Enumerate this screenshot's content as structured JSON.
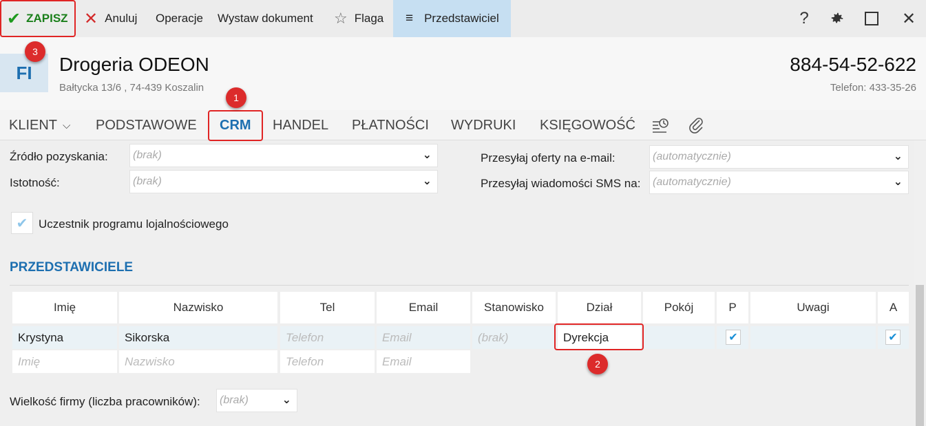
{
  "toolbar": {
    "save": "ZAPISZ",
    "cancel": "Anuluj",
    "operations": "Operacje",
    "issue_document": "Wystaw dokument",
    "flag": "Flaga",
    "representative": "Przedstawiciel",
    "help_icon": "?",
    "settings_icon": "gear-icon",
    "maximize_icon": "maximize-icon",
    "close_icon": "close-icon"
  },
  "header": {
    "avatar": "FI",
    "company_name": "Drogeria ODEON",
    "address": "Bałtycka  13/6 , 74-439 Koszalin",
    "nip": "884-54-52-622",
    "phone": "Telefon: 433-35-26"
  },
  "tabs": {
    "klient": "KLIENT",
    "podstawowe": "PODSTAWOWE",
    "crm": "CRM",
    "handel": "HANDEL",
    "platnosci": "PŁATNOŚCI",
    "wydruki": "WYDRUKI",
    "ksiegowosc": "KSIĘGOWOŚĆ",
    "active": "CRM"
  },
  "form": {
    "source_label": "Źródło pozyskania:",
    "source_value": "(brak)",
    "importance_label": "Istotność:",
    "importance_value": "(brak)",
    "email_offers_label": "Przesyłaj oferty na e-mail:",
    "email_offers_value": "(automatycznie)",
    "sms_label": "Przesyłaj wiadomości SMS na:",
    "sms_value": "(automatycznie)",
    "loyalty_label": "Uczestnik programu lojalnościowego",
    "loyalty_checked": true
  },
  "representatives": {
    "title": "PRZEDSTAWICIELE",
    "columns": [
      "Imię",
      "Nazwisko",
      "Tel",
      "Email",
      "Stanowisko",
      "Dział",
      "Pokój",
      "P",
      "Uwagi",
      "A"
    ],
    "row1": {
      "first_name": "Krystyna",
      "last_name": "Sikorska",
      "phone_placeholder": "Telefon",
      "email_placeholder": "Email",
      "position": "(brak)",
      "department": "Dyrekcja",
      "room": "",
      "p_checked": true,
      "notes": "",
      "a_checked": true
    },
    "new_row": {
      "first_name_placeholder": "Imię",
      "last_name_placeholder": "Nazwisko",
      "phone_placeholder": "Telefon",
      "email_placeholder": "Email"
    }
  },
  "company_size": {
    "label": "Wielkość firmy (liczba pracowników):",
    "value": "(brak)"
  },
  "annotations": {
    "b1": "1",
    "b2": "2",
    "b3": "3",
    "color": "#dc2b2b"
  }
}
